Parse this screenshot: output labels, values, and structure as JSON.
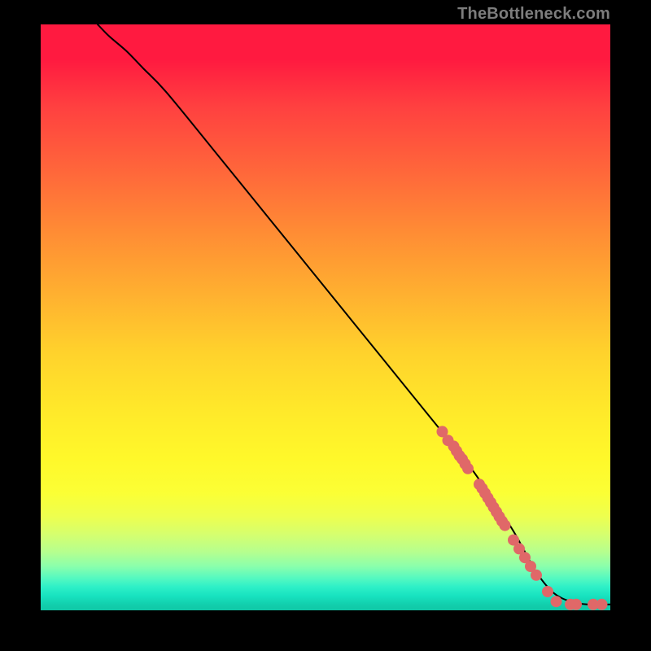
{
  "watermark": "TheBottleneck.com",
  "colors": {
    "background": "#000000",
    "curve": "#000000",
    "marker": "#e06868",
    "watermark": "#7d7d7d"
  },
  "chart_data": {
    "type": "line",
    "title": "",
    "xlabel": "",
    "ylabel": "",
    "xlim": [
      0,
      100
    ],
    "ylim": [
      0,
      100
    ],
    "grid": false,
    "series": [
      {
        "name": "curve",
        "x": [
          10,
          12,
          15,
          18,
          22,
          30,
          40,
          50,
          60,
          70,
          75,
          80,
          83,
          85,
          87,
          90,
          93,
          96,
          100
        ],
        "y": [
          100,
          98,
          95.5,
          92.5,
          88.5,
          79,
          67,
          55,
          43,
          31,
          25,
          18,
          13.5,
          10,
          6.5,
          3,
          1.5,
          1,
          1
        ]
      }
    ],
    "markers": {
      "name": "highlighted-points",
      "x": [
        70.5,
        71.5,
        72.5,
        73,
        73.5,
        74,
        74.5,
        75,
        77,
        77.5,
        78,
        78.5,
        79,
        79.5,
        80,
        80.5,
        81,
        81.5,
        83,
        84,
        85,
        86,
        87,
        89,
        90.5,
        93,
        94,
        97,
        98.5
      ],
      "y": [
        30.5,
        29,
        28,
        27.2,
        26.4,
        25.8,
        25,
        24.2,
        21.5,
        20.8,
        20,
        19.2,
        18.4,
        17.6,
        16.8,
        16,
        15.2,
        14.5,
        12,
        10.5,
        9,
        7.5,
        6,
        3.2,
        1.5,
        1,
        1,
        1,
        1
      ]
    }
  }
}
